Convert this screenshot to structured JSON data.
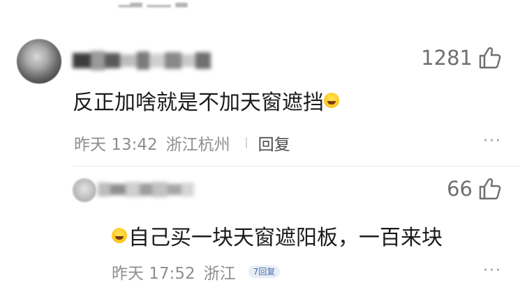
{
  "comments": [
    {
      "user_name": "█████",
      "likes": "1281",
      "text": "反正加啥就是不加天窗遮挡",
      "trailing_emoji": "laughing-emoji",
      "time": "昨天 13:42",
      "location": "浙江杭州",
      "reply_label": "回复",
      "more_label": "···"
    }
  ],
  "replies": [
    {
      "user_name": "████",
      "likes": "66",
      "leading_emoji": "laughing-emoji",
      "text": "自己买一块天窗遮阳板，一百来块",
      "time": "昨天 17:52",
      "location": "浙江",
      "reply_count_label": "7回复",
      "more_label": "···"
    }
  ],
  "colors": {
    "meta_gray": "#8e8e8e",
    "like_gray": "#6f6f6f",
    "badge_blue": "#4a6ea8",
    "badge_bg": "#e8edf6"
  }
}
